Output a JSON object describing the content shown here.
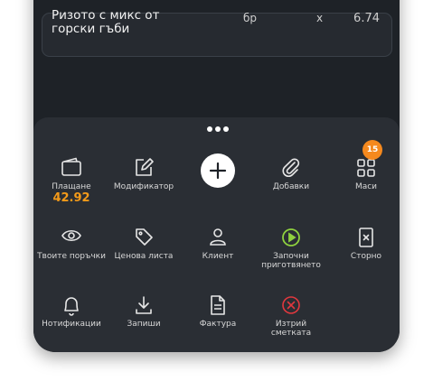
{
  "order_item": {
    "name": "Ризото с микс от горски гъби",
    "unit": "бр",
    "multiplier": "x",
    "price": "6.74"
  },
  "menu": {
    "payment": {
      "label": "Плащане",
      "amount": "42.92",
      "icon": "wallet-icon"
    },
    "modifier": {
      "label": "Модификатор",
      "icon": "edit-icon"
    },
    "add": {
      "icon": "plus-icon"
    },
    "extras": {
      "label": "Добавки",
      "icon": "paperclip-icon"
    },
    "tables": {
      "label": "Маси",
      "badge": "15",
      "icon": "grid-icon"
    },
    "orders": {
      "label": "Твоите поръчки",
      "icon": "eye-icon"
    },
    "price_list": {
      "label": "Ценова листа",
      "icon": "tag-icon"
    },
    "client": {
      "label": "Клиент",
      "icon": "user-icon"
    },
    "start_prep": {
      "label": "Започни приготвянето",
      "icon": "play-circle-icon"
    },
    "storno": {
      "label": "Сторно",
      "icon": "cancel-doc-icon"
    },
    "notifications": {
      "label": "Нотификации",
      "icon": "bell-icon"
    },
    "save": {
      "label": "Запиши",
      "icon": "download-icon"
    },
    "invoice": {
      "label": "Фактура",
      "icon": "document-icon"
    },
    "delete_bill": {
      "label": "Изтрий сметката",
      "icon": "x-circle-icon"
    }
  },
  "colors": {
    "accent_orange": "#f5891e",
    "amount_orange": "#f59b19",
    "play_green": "#8fd13f",
    "delete_red": "#e0383e",
    "background": "#1e2227",
    "sheet": "#2a2e34"
  }
}
